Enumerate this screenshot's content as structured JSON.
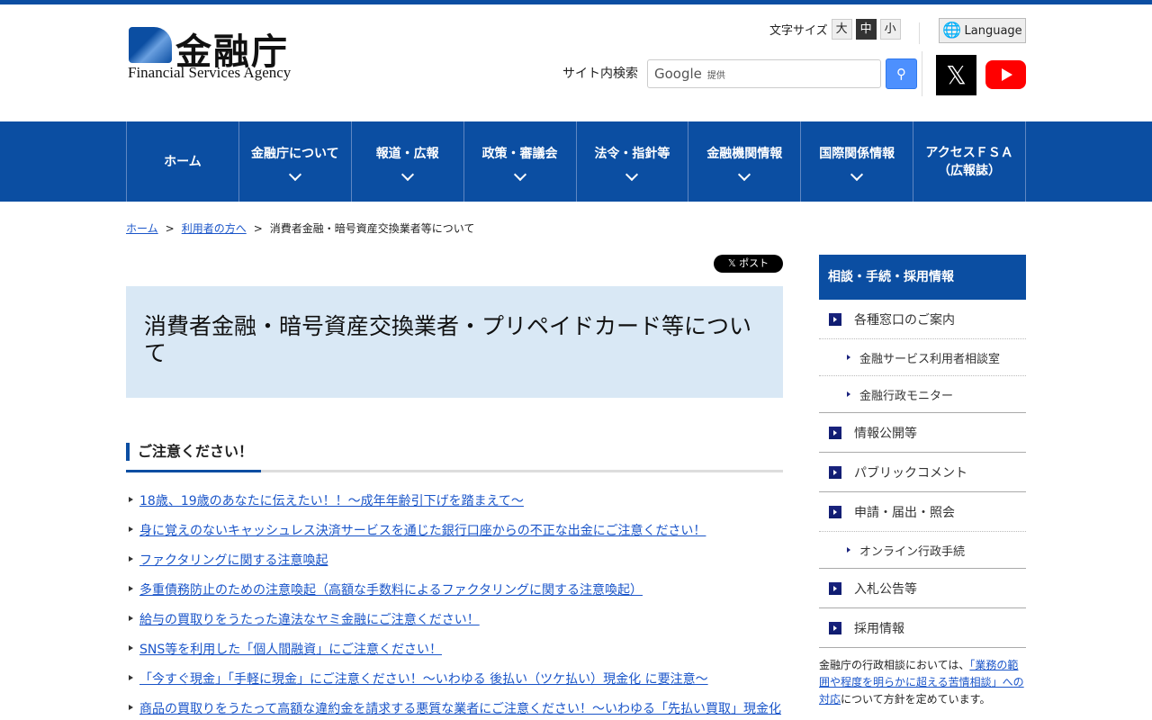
{
  "header": {
    "logo_kanji": "金融庁",
    "logo_en": "Financial Services Agency",
    "font_size_label": "文字サイズ",
    "font_sizes": [
      "大",
      "中",
      "小"
    ],
    "language": "Language",
    "search_label": "サイト内検索",
    "search_google": "Google",
    "search_provided": "提供",
    "x_icon": "𝕏"
  },
  "nav": [
    "ホーム",
    "金融庁について",
    "報道・広報",
    "政策・審議会",
    "法令・指針等",
    "金融機関情報",
    "国際関係情報",
    "アクセスＦＳＡ\n（広報誌）"
  ],
  "breadcrumb": {
    "home": "ホーム",
    "sep": ">",
    "parent": "利用者の方へ",
    "current": "消費者金融・暗号資産交換業者等について"
  },
  "main": {
    "post_button": "𝕏 ポスト",
    "title": "消費者金融・暗号資産交換業者・プリペイドカード等について",
    "section_title": "ご注意ください！",
    "links": [
      "18歳、19歳のあなたに伝えたい！！～成年年齢引下げを踏まえて～",
      "身に覚えのないキャッシュレス決済サービスを通じた銀行口座からの不正な出金にご注意ください！",
      "ファクタリングに関する注意喚起",
      "多重債務防止のための注意喚起（高額な手数料によるファクタリングに関する注意喚起）",
      "給与の買取りをうたった違法なヤミ金融にご注意ください！",
      "SNS等を利用した「個人間融資」にご注意ください！",
      "「今すぐ現金」「手軽に現金」にご注意ください！～いわゆる 後払い（ツケ払い）現金化 に要注意～",
      "商品の買取りをうたって高額な違約金を請求する悪質な業者にご注意ください！～いわゆる「先払い買取」現金化"
    ]
  },
  "sidebar": {
    "title": "相談・手続・採用情報",
    "items": {
      "a": "各種窓口のご案内",
      "a1": "金融サービス利用者相談室",
      "a2": "金融行政モニター",
      "b": "情報公開等",
      "c": "パブリックコメント",
      "d": "申請・届出・照会",
      "d1": "オンライン行政手続",
      "e": "入札公告等",
      "f": "採用情報"
    },
    "note_pre": "金融庁の行政相談においては、",
    "note_link": "「業務の範囲や程度を明らかに超える苦情相談」への対応",
    "note_post": "について方針を定めています。"
  },
  "colors": {
    "brand": "#0b4ea2",
    "link": "#1a55c9",
    "title_bg": "#d9e8f5"
  }
}
